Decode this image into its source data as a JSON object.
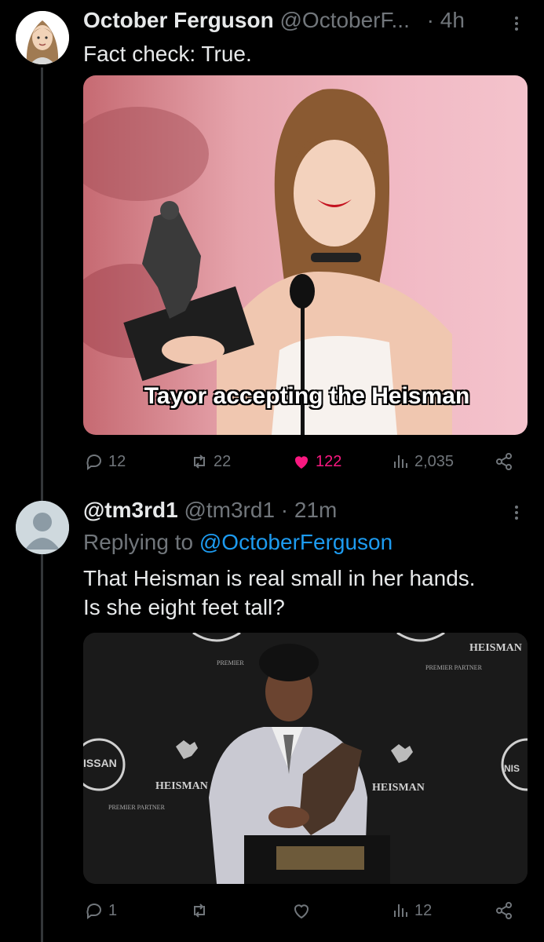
{
  "colors": {
    "background": "#000000",
    "text": "#e7e9ea",
    "muted": "#71767b",
    "link": "#1d9bf0",
    "like": "#f91880"
  },
  "tweet1": {
    "display_name": "October Ferguson",
    "handle": "@OctoberF...",
    "time": "· 4h",
    "text": "Fact check: True.",
    "media_caption": "Tayor accepting the Heisman",
    "replies": "12",
    "retweets": "22",
    "likes": "122",
    "views": "2,035",
    "liked": true
  },
  "tweet2": {
    "display_name": "@tm3rd1",
    "handle_time": "@tm3rd1 · 21m",
    "replying_prefix": "Replying to",
    "replying_to": "@OctoberFerguson",
    "text_line1": "That Heisman is real small in her hands.",
    "text_line2": "Is she eight feet tall?",
    "replies": "1",
    "views": "12",
    "backdrop": {
      "heisman": "HEISMAN",
      "partner": "PREMIER PARTNER",
      "premier": "PREMIER",
      "nissan": "ISSAN",
      "nis": "NIS"
    }
  },
  "icons": [
    "more-icon",
    "reply-icon",
    "retweet-icon",
    "like-icon",
    "views-icon",
    "share-icon"
  ]
}
